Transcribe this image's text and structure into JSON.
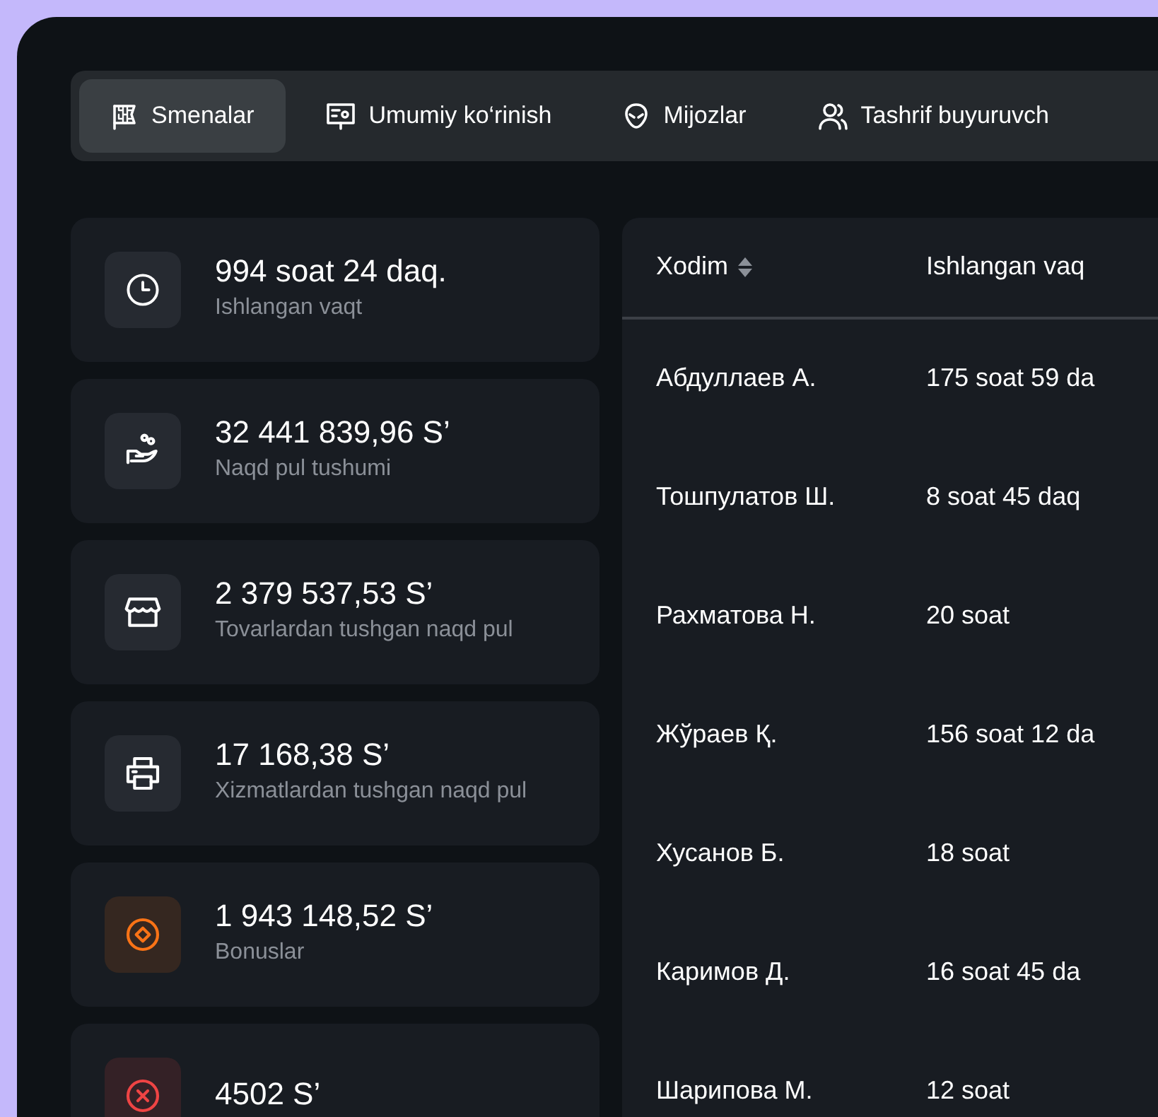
{
  "tabs": [
    {
      "label": "Smenalar",
      "kind": "flag",
      "selected": true
    },
    {
      "label": "Umumiy ko‘rinish",
      "kind": "screen",
      "selected": false
    },
    {
      "label": "Mijozlar",
      "kind": "alien",
      "selected": false
    },
    {
      "label": "Tashrif buyuruvch",
      "kind": "users",
      "selected": false
    }
  ],
  "stats": [
    {
      "value": "994 soat 24 daq.",
      "label": "Ishlangan vaqt",
      "kind": "clock",
      "color": "#ffffff"
    },
    {
      "value": "32 441 839,96 S’",
      "label": "Naqd pul tushumi",
      "kind": "hand",
      "color": "#ffffff"
    },
    {
      "value": "2 379 537,53 S’",
      "label": "Tovarlardan tushgan naqd pul",
      "kind": "store",
      "color": "#ffffff"
    },
    {
      "value": "17 168,38 S’",
      "label": "Xizmatlardan tushgan naqd pul",
      "kind": "printer",
      "color": "#ffffff"
    },
    {
      "value": "1 943 148,52 S’",
      "label": "Bonuslar",
      "kind": "coin",
      "color": "#f97316"
    },
    {
      "value": "4502 S’",
      "kind": "cross",
      "color": "#ef4444"
    }
  ],
  "table": {
    "columns": [
      {
        "label": "Xodim",
        "sortable": true
      },
      {
        "label": "Ishlangan vaq",
        "sortable": false
      }
    ],
    "rows": [
      [
        "Абдуллаев А.",
        "175 soat 59 da"
      ],
      [
        "Тошпулатов Ш.",
        "8 soat 45 daq"
      ],
      [
        "Рахматова Н.",
        "20 soat"
      ],
      [
        "Жўраев Қ.",
        "156 soat 12 da"
      ],
      [
        "Хусанов Б.",
        "18 soat"
      ],
      [
        "Каримов Д.",
        "16 soat 45 da"
      ],
      [
        "Шарипова М.",
        "12 soat"
      ]
    ]
  }
}
